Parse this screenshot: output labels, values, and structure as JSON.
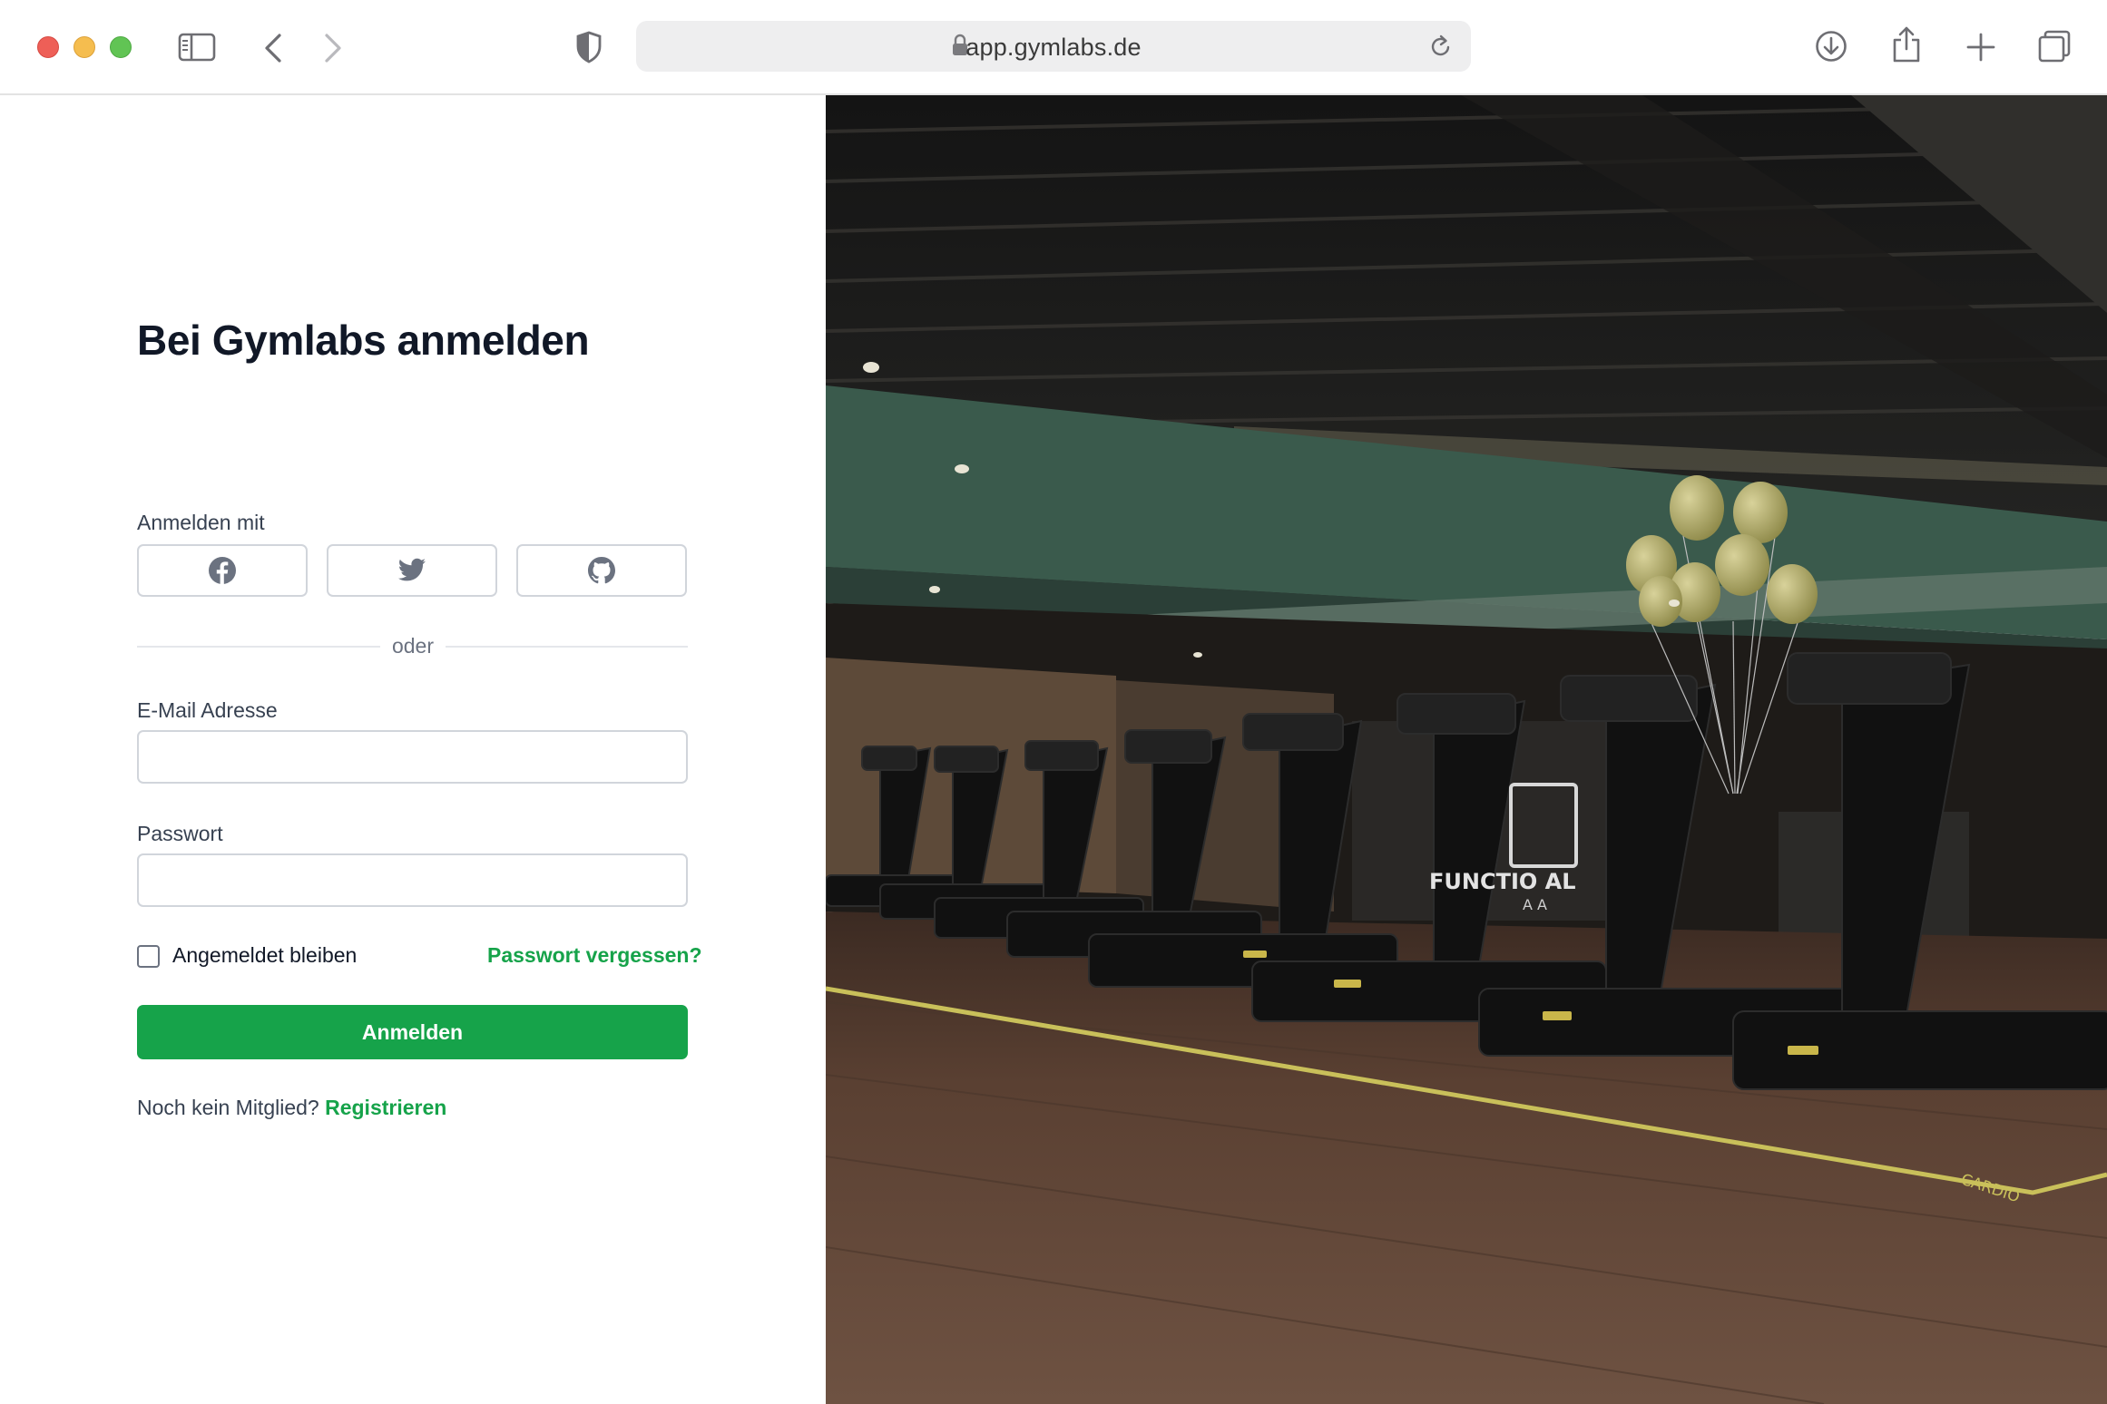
{
  "browser": {
    "url": "app.gymlabs.de",
    "icons": [
      "sidebar-icon",
      "back-icon",
      "forward-icon",
      "shield-icon",
      "lock-icon",
      "reload-icon",
      "download-icon",
      "share-icon",
      "new-tab-icon",
      "tabs-overview-icon"
    ]
  },
  "login": {
    "title": "Bei Gymlabs anmelden",
    "social_label": "Anmelden mit",
    "social_providers": [
      "facebook",
      "twitter",
      "github"
    ],
    "divider": "oder",
    "email_label": "E-Mail Adresse",
    "email_value": "",
    "password_label": "Passwort",
    "password_value": "",
    "remember_label": "Angemeldet bleiben",
    "remember_checked": false,
    "forgot_link": "Passwort vergessen?",
    "submit_label": "Anmelden",
    "register_prompt": "Noch kein Mitglied?",
    "register_link": "Registrieren"
  },
  "hero": {
    "sign_text": "FUNCTIO AL",
    "sign_subtext": "A    A",
    "floor_text": "CARDIO"
  },
  "colors": {
    "accent": "#16a34a",
    "heading": "#111827",
    "border": "#d1d5db"
  }
}
